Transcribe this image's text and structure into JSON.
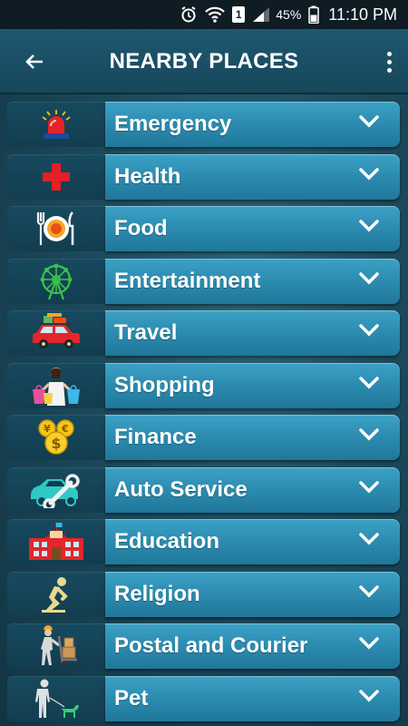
{
  "status_bar": {
    "battery_percent": "45%",
    "time": "11:10 PM",
    "sim_label": "1"
  },
  "app_bar": {
    "title": "NEARBY PLACES"
  },
  "categories": [
    {
      "label": "Emergency",
      "icon": "siren-icon"
    },
    {
      "label": "Health",
      "icon": "red-cross-icon"
    },
    {
      "label": "Food",
      "icon": "plate-fork-knife-icon"
    },
    {
      "label": "Entertainment",
      "icon": "ferris-wheel-icon"
    },
    {
      "label": "Travel",
      "icon": "car-luggage-icon"
    },
    {
      "label": "Shopping",
      "icon": "shopping-woman-icon"
    },
    {
      "label": "Finance",
      "icon": "coins-icon"
    },
    {
      "label": "Auto Service",
      "icon": "car-wrench-icon"
    },
    {
      "label": "Education",
      "icon": "school-building-icon"
    },
    {
      "label": "Religion",
      "icon": "praying-person-icon"
    },
    {
      "label": "Postal and Courier",
      "icon": "courier-cart-icon"
    },
    {
      "label": "Pet",
      "icon": "person-walking-dog-icon"
    }
  ],
  "colors": {
    "bar_top": "#3ca1c6",
    "bar_bottom": "#20779a",
    "icon_box": "#174a5f",
    "app_bar": "#1f5870",
    "status_bar": "#0f1c23"
  }
}
